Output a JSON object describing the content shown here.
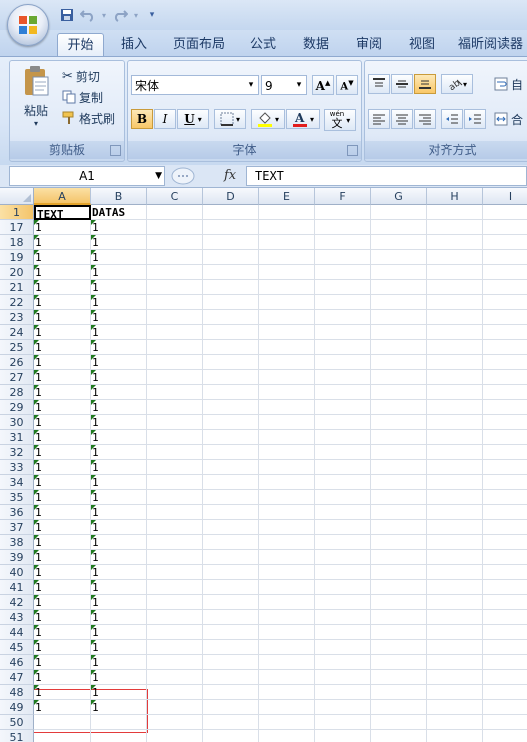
{
  "qat": {
    "items": [
      "save-icon",
      "undo-icon",
      "redo-icon",
      "customize-icon"
    ]
  },
  "tabs": [
    {
      "label": "开始",
      "active": true
    },
    {
      "label": "插入",
      "active": false
    },
    {
      "label": "页面布局",
      "active": false
    },
    {
      "label": "公式",
      "active": false
    },
    {
      "label": "数据",
      "active": false
    },
    {
      "label": "审阅",
      "active": false
    },
    {
      "label": "视图",
      "active": false
    },
    {
      "label": "福昕阅读器",
      "active": false
    }
  ],
  "ribbon": {
    "clipboard": {
      "label": "剪贴板",
      "paste": "粘贴",
      "cut": "剪切",
      "copy": "复制",
      "format_painter": "格式刷"
    },
    "font": {
      "label": "字体",
      "font_name": "宋体",
      "font_size": "9",
      "bold": "B",
      "italic": "I",
      "underline": "U",
      "phonetic": "wén"
    },
    "alignment": {
      "label": "对齐方式",
      "wrap_fragment": "自",
      "merge_fragment": "合"
    }
  },
  "formula_bar": {
    "name_box": "A1",
    "fx": "fx",
    "content": "TEXT"
  },
  "sheet": {
    "columns": [
      "A",
      "B",
      "C",
      "D",
      "E",
      "F",
      "G",
      "H",
      "I"
    ],
    "header_row": {
      "row": "1",
      "a": "TEXT",
      "b": "DATAS"
    },
    "rows": [
      {
        "row": "17",
        "a": "1",
        "b": "1"
      },
      {
        "row": "18",
        "a": "1",
        "b": "1"
      },
      {
        "row": "19",
        "a": "1",
        "b": "1"
      },
      {
        "row": "20",
        "a": "1",
        "b": "1"
      },
      {
        "row": "21",
        "a": "1",
        "b": "1"
      },
      {
        "row": "22",
        "a": "1",
        "b": "1"
      },
      {
        "row": "23",
        "a": "1",
        "b": "1"
      },
      {
        "row": "24",
        "a": "1",
        "b": "1"
      },
      {
        "row": "25",
        "a": "1",
        "b": "1"
      },
      {
        "row": "26",
        "a": "1",
        "b": "1"
      },
      {
        "row": "27",
        "a": "1",
        "b": "1"
      },
      {
        "row": "28",
        "a": "1",
        "b": "1"
      },
      {
        "row": "29",
        "a": "1",
        "b": "1"
      },
      {
        "row": "30",
        "a": "1",
        "b": "1"
      },
      {
        "row": "31",
        "a": "1",
        "b": "1"
      },
      {
        "row": "32",
        "a": "1",
        "b": "1"
      },
      {
        "row": "33",
        "a": "1",
        "b": "1"
      },
      {
        "row": "34",
        "a": "1",
        "b": "1"
      },
      {
        "row": "35",
        "a": "1",
        "b": "1"
      },
      {
        "row": "36",
        "a": "1",
        "b": "1"
      },
      {
        "row": "37",
        "a": "1",
        "b": "1"
      },
      {
        "row": "38",
        "a": "1",
        "b": "1"
      },
      {
        "row": "39",
        "a": "1",
        "b": "1"
      },
      {
        "row": "40",
        "a": "1",
        "b": "1"
      },
      {
        "row": "41",
        "a": "1",
        "b": "1"
      },
      {
        "row": "42",
        "a": "1",
        "b": "1"
      },
      {
        "row": "43",
        "a": "1",
        "b": "1"
      },
      {
        "row": "44",
        "a": "1",
        "b": "1"
      },
      {
        "row": "45",
        "a": "1",
        "b": "1"
      },
      {
        "row": "46",
        "a": "1",
        "b": "1"
      },
      {
        "row": "47",
        "a": "1",
        "b": "1"
      },
      {
        "row": "48",
        "a": "1",
        "b": "1"
      },
      {
        "row": "49",
        "a": "1",
        "b": "1"
      },
      {
        "row": "50",
        "a": "",
        "b": ""
      },
      {
        "row": "51",
        "a": "",
        "b": ""
      }
    ]
  },
  "colors": {
    "selection_header": "#f4c46a",
    "error_indicator": "#1f7a1f",
    "annotation_box": "#e33b3b"
  }
}
